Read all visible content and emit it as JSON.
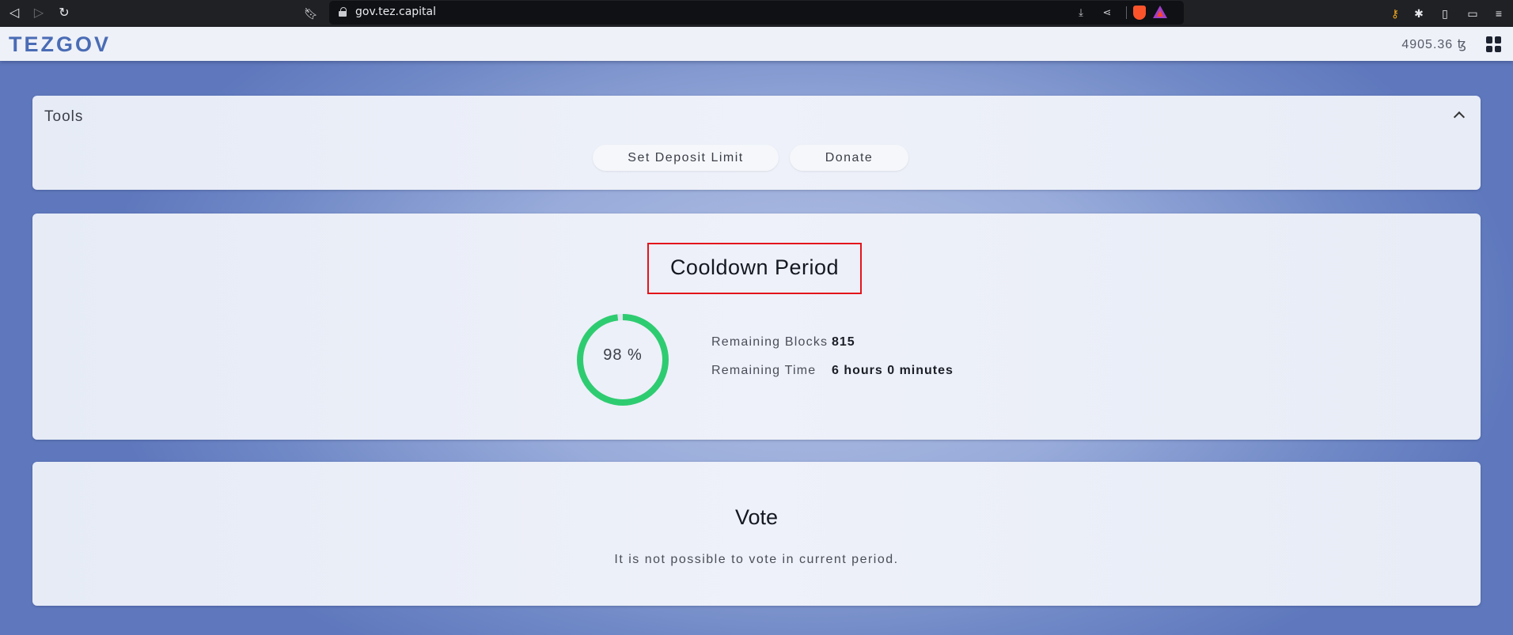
{
  "browser": {
    "url": "gov.tez.capital"
  },
  "app": {
    "logo": "TEZGOV",
    "balance": "4905.36 ꜩ"
  },
  "tools": {
    "title": "Tools",
    "buttons": [
      "Set Deposit Limit",
      "Donate"
    ]
  },
  "period": {
    "title": "Cooldown Period",
    "progress_label": "98 %",
    "progress_fraction": 0.98,
    "accent_color": "#2ecc71",
    "stats": [
      {
        "label": "Remaining Blocks",
        "value": "815"
      },
      {
        "label": "Remaining Time",
        "value": "6 hours 0 minutes"
      }
    ]
  },
  "vote": {
    "title": "Vote",
    "message": "It is not possible to vote in current period."
  },
  "colors": {
    "brand": "#4a6cb5",
    "highlight_box": "#e4141b"
  }
}
